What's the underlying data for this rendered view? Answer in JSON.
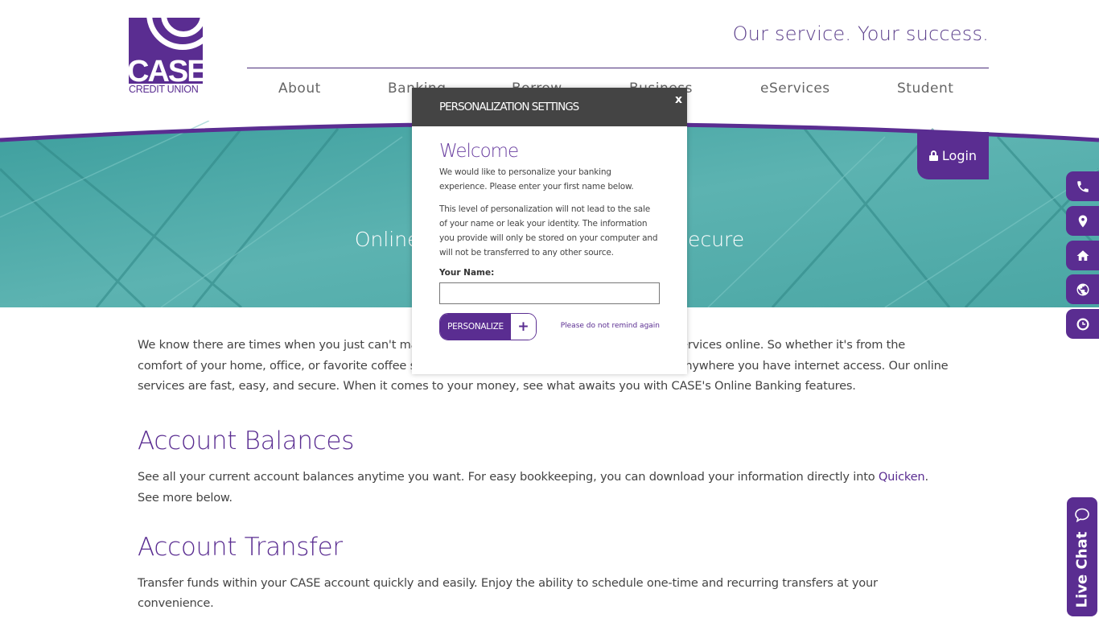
{
  "brand": {
    "name": "CASE",
    "subtitle": "CREDIT UNION",
    "color": "#5a2d91"
  },
  "header": {
    "tagline": "Our service. Your success."
  },
  "nav": [
    "About",
    "Banking",
    "Borrow",
    "Business",
    "eServices",
    "Student"
  ],
  "hero": {
    "title": "Online Services: Fast, Easy and Secure"
  },
  "login": {
    "label": "Login",
    "icon": "lock-icon"
  },
  "side_icons": [
    "phone-icon",
    "map-marker-icon",
    "home-icon",
    "globe-icon",
    "clock-icon"
  ],
  "live_chat": {
    "label": "Live Chat",
    "icon": "chat-bubble-icon"
  },
  "content": {
    "intro": "We know there are times when you just can't make it to a branch, which is why we offer 24/7 services online. So whether it's from the comfort of your home, office, or favorite coffee shop, you can access your accounts any time, anywhere you have internet access. Our online services are fast, easy, and secure. When it comes to your money, see what awaits you with CASE's Online Banking features.",
    "sections": [
      {
        "title": "Account Balances",
        "text_before": "See all your current account balances anytime you want. For easy bookkeeping, you can download your information directly into ",
        "link": "Quicken",
        "text_after": ". See more below."
      },
      {
        "title": "Account Transfer",
        "text": "Transfer funds within your CASE account quickly and easily. Enjoy the ability to schedule one-time and recurring transfers at your convenience."
      }
    ]
  },
  "modal": {
    "title": "PERSONALIZATION SETTINGS",
    "close": "x",
    "welcome": "Welcome",
    "p1": "We would like to personalize your banking experience. Please enter your first name below.",
    "p2": "This level of personalization will not lead to the sale of your name or leak your identity. The information you provide will only be stored on your computer and will not be transferred to any other source.",
    "name_label": "Your Name:",
    "name_value": "",
    "button": "PERSONALIZE",
    "button_icon": "+",
    "no_remind": "Please do not remind again"
  }
}
